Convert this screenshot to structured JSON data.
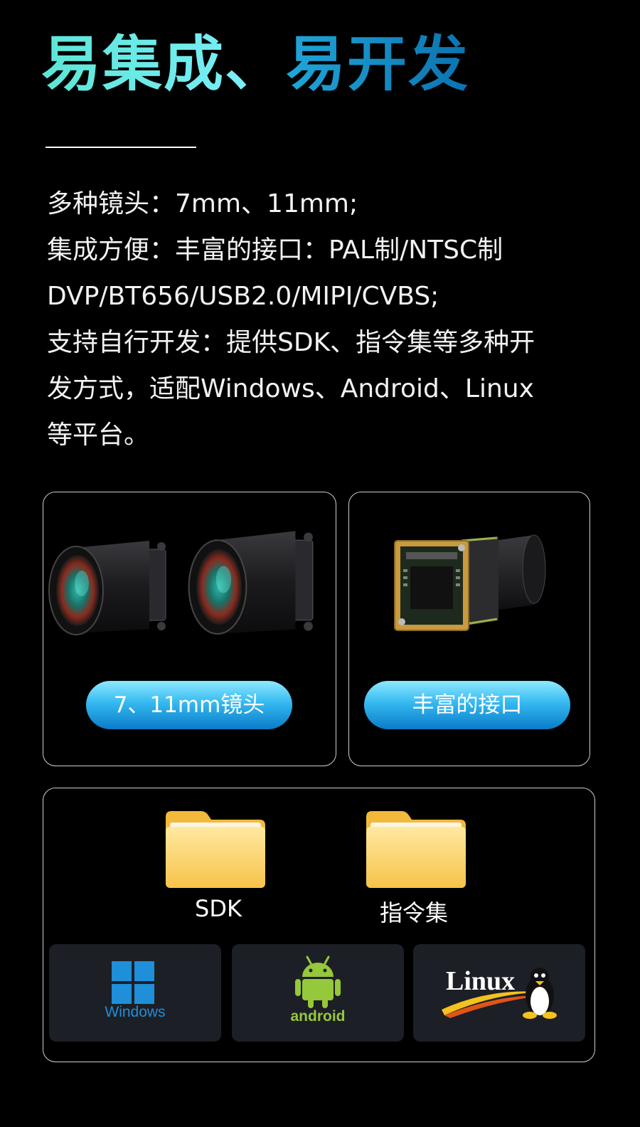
{
  "headline": {
    "part1": "易集成、",
    "part2": "易开发"
  },
  "description": [
    "多种镜头：7mm、11mm;",
    "集成方便：丰富的接口：PAL制/NTSC制",
    "DVP/BT656/USB2.0/MIPI/CVBS;",
    "支持自行开发：提供SDK、指令集等多种开",
    "发方式，适配Windows、Android、Linux",
    "等平台。"
  ],
  "cards": {
    "lens": {
      "label": "7、11mm镜头",
      "icon": "camera-lens-icon"
    },
    "interface": {
      "label": "丰富的接口",
      "icon": "camera-module-icon"
    }
  },
  "software": {
    "folders": [
      {
        "label": "SDK",
        "icon": "folder-icon"
      },
      {
        "label": "指令集",
        "icon": "folder-icon"
      }
    ],
    "platforms": [
      {
        "name": "Windows",
        "icon": "windows-logo-icon"
      },
      {
        "name": "android",
        "icon": "android-logo-icon"
      },
      {
        "name": "Linux",
        "icon": "linux-tux-icon"
      }
    ]
  },
  "colors": {
    "accent_cyan": "#5ce6d6",
    "accent_blue": "#1fa6d8",
    "pill_blue": "#35b9f0",
    "windows_blue": "#1e8fd8",
    "android_green": "#95c83a"
  }
}
